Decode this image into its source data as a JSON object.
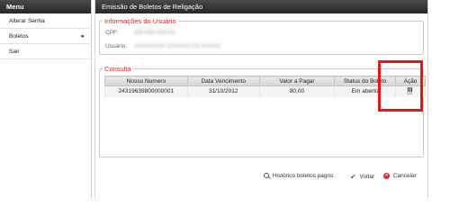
{
  "sidebar": {
    "title": "Menu",
    "items": [
      {
        "label": "Alterar Senha"
      },
      {
        "label": "Boletos",
        "submenu_indicator": "▸"
      },
      {
        "label": "Sair"
      }
    ]
  },
  "main": {
    "title": "Emissão de Boletos de Religação",
    "user_info": {
      "legend": "Informações do Usuário",
      "cpf_label": "CPF:",
      "cpf_value": "000.000.000-00",
      "user_label": "Usuário:",
      "user_value": "XXXXXXXX XXXXXX XX XXXXX"
    },
    "consulta": {
      "legend": "Consulta",
      "columns": [
        "Nosso Numero",
        "Data Vencimento",
        "Valor a Pagar",
        "Status do Boleto",
        "Ação"
      ],
      "rows": [
        {
          "nosso_numero": "24319639800000001",
          "vencimento": "31/10/2012",
          "valor": "80,00",
          "status": "Em aberto",
          "acao_icon": "barcode-icon",
          "acao_icon_text": "123"
        }
      ]
    },
    "footer": {
      "historico_label": "Histórico boletos pagos",
      "voltar_label": "Voltar",
      "cancelar_label": "Cancelar",
      "cancel_glyph": "×"
    }
  },
  "colors": {
    "header_bg": "#2e2e2e",
    "legend_red": "#cc2b1e",
    "highlight_red": "#e01818"
  }
}
